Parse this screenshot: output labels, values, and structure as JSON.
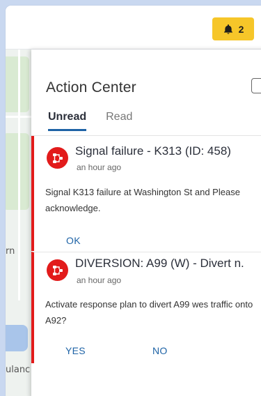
{
  "topbar": {
    "notification_count": "2",
    "bell_icon": "bell-icon"
  },
  "map": {
    "label_1": "rn",
    "label_2": "ulanc"
  },
  "action_center": {
    "title": "Action Center",
    "tabs": [
      {
        "label": "Unread",
        "active": true
      },
      {
        "label": "Read",
        "active": false
      }
    ],
    "notifications": [
      {
        "title": "Signal failure - K313 (ID: 458)",
        "time": "an hour ago",
        "body": "Signal K313 failure at Washington St and Please acknowledge.",
        "actions": [
          "OK"
        ],
        "icon": "traffic-network-icon",
        "accent": "#e21b1b"
      },
      {
        "title": "DIVERSION: A99 (W) - Divert n.",
        "time": "an hour ago",
        "body": "Activate response plan to divert A99 wes traffic onto A92?",
        "actions": [
          "YES",
          "NO"
        ],
        "icon": "traffic-network-icon",
        "accent": "#e21b1b"
      }
    ]
  },
  "colors": {
    "accent_blue": "#1e63a6",
    "alert_red": "#e21b1b",
    "notif_yellow": "#f6c629"
  }
}
